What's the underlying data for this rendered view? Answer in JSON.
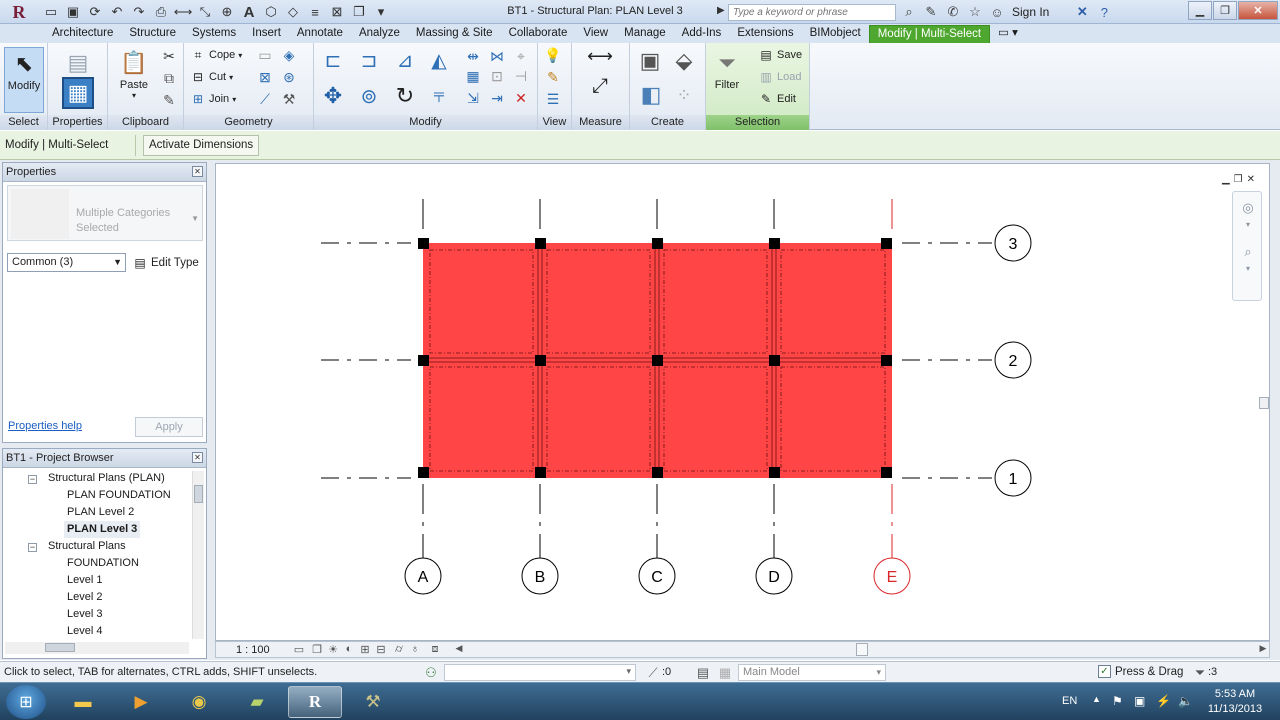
{
  "titlebar": {
    "logo": "R",
    "doc_title": "BT1 - Structural Plan: PLAN Level 3",
    "search_placeholder": "Type a keyword or phrase",
    "sign_in": "Sign In"
  },
  "ribbon_tabs": [
    {
      "label": "Architecture"
    },
    {
      "label": "Structure"
    },
    {
      "label": "Systems"
    },
    {
      "label": "Insert"
    },
    {
      "label": "Annotate"
    },
    {
      "label": "Analyze"
    },
    {
      "label": "Massing & Site"
    },
    {
      "label": "Collaborate"
    },
    {
      "label": "View"
    },
    {
      "label": "Manage"
    },
    {
      "label": "Add-Ins"
    },
    {
      "label": "Extensions"
    },
    {
      "label": "BIMobject"
    },
    {
      "label": "Modify | Multi-Select"
    }
  ],
  "ribbon": {
    "modify": "Modify",
    "paste": "Paste",
    "cope": "Cope",
    "cut": "Cut",
    "join": "Join",
    "filter": "Filter",
    "save": "Save",
    "load": "Load",
    "edit": "Edit",
    "panels": {
      "select": "Select",
      "properties": "Properties",
      "clipboard": "Clipboard",
      "geometry": "Geometry",
      "modify": "Modify",
      "view": "View",
      "measure": "Measure",
      "create": "Create",
      "selection": "Selection"
    }
  },
  "options_bar": {
    "context": "Modify | Multi-Select",
    "activate_dimensions": "Activate Dimensions"
  },
  "properties": {
    "title": "Properties",
    "type_name": "Multiple Categories Selected",
    "filter_value": "Common (3)",
    "edit_type": "Edit Type",
    "help_link": "Properties help",
    "apply": "Apply"
  },
  "project_browser": {
    "title": "BT1 - Project Browser",
    "items": [
      {
        "label": "Structural Plans (PLAN)"
      },
      {
        "label": "PLAN  FOUNDATION"
      },
      {
        "label": "PLAN Level 2"
      },
      {
        "label": "PLAN Level 3"
      },
      {
        "label": "Structural Plans"
      },
      {
        "label": "FOUNDATION"
      },
      {
        "label": "Level 1"
      },
      {
        "label": "Level 2"
      },
      {
        "label": "Level 3"
      },
      {
        "label": "Level 4"
      }
    ]
  },
  "drawing": {
    "grid_columns": [
      "A",
      "B",
      "C",
      "D",
      "E"
    ],
    "grid_rows": [
      "3",
      "2",
      "1"
    ],
    "selected_fill": "#ff4545",
    "highlight_grid_color": "#d9262b",
    "scale": "1 : 100"
  },
  "statusbar": {
    "hint": "Click to select, TAB for alternates, CTRL adds, SHIFT unselects.",
    "zero": ":0",
    "model": "Main Model",
    "press_drag": "Press & Drag",
    "filter_count": ":3"
  },
  "taskbar": {
    "lang": "EN",
    "time": "5:53 AM",
    "date": "11/13/2013"
  }
}
